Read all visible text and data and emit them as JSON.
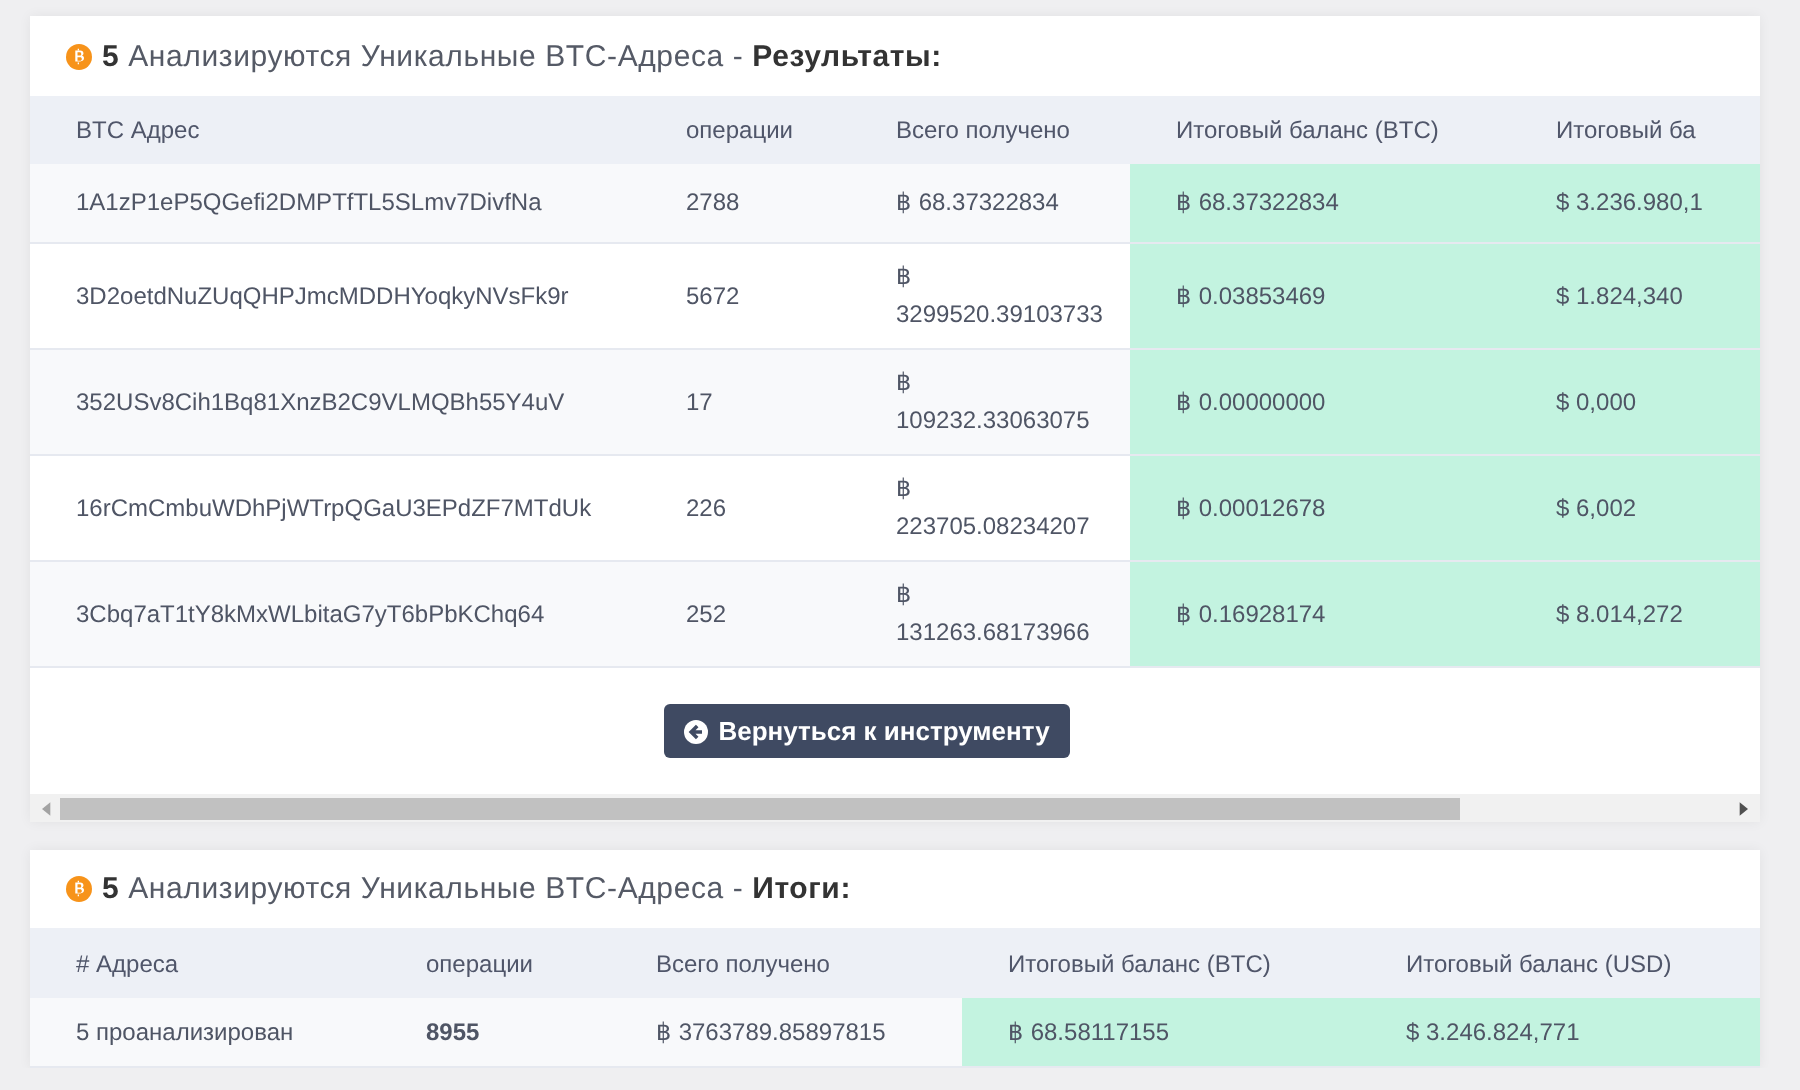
{
  "results": {
    "title": "**5** Анализируются Уникальные BTC-Адреса - **Результаты:**",
    "columns": [
      {
        "label": "BTC Адрес",
        "highlighted": false
      },
      {
        "label": "операции",
        "highlighted": false
      },
      {
        "label": "Всего получено",
        "highlighted": false
      },
      {
        "label": "Итоговый баланс (BTC)",
        "highlighted": true
      },
      {
        "label": "Итоговый ба",
        "highlighted": true
      }
    ],
    "rows": [
      [
        "1A1zP1eP5QGefi2DMPTfTL5SLmv7DivfNa",
        "2788",
        "฿ 68.37322834",
        "฿ 68.37322834",
        "$ 3.236.980,1"
      ],
      [
        "3D2oetdNuZUqQHPJmcMDDHYoqkyNVsFk9r",
        "5672",
        "฿ 3299520.39103733",
        "฿ 0.03853469",
        "$ 1.824,340"
      ],
      [
        "352USv8Cih1Bq81XnzB2C9VLMQBh55Y4uV",
        "17",
        "฿ 109232.33063075",
        "฿ 0.00000000",
        "$ 0,000"
      ],
      [
        "16rCmCmbuWDhPjWTrpQGaU3EPdZF7MTdUk",
        "226",
        "฿ 223705.08234207",
        "฿ 0.00012678",
        "$ 6,002"
      ],
      [
        "3Cbq7aT1tY8kMxWLbitaG7yT6bPbKChq64",
        "252",
        "฿ 131263.68173966",
        "฿ 0.16928174",
        "$ 8.014,272"
      ]
    ],
    "button": "Вернуться к инструменту"
  },
  "totals": {
    "title": "**5** Анализируются Уникальные BTC-Адреса - **Итоги:**",
    "columns": [
      {
        "label": "# Адреса",
        "highlighted": false
      },
      {
        "label": "операции",
        "highlighted": false
      },
      {
        "label": "Всего получено",
        "highlighted": false
      },
      {
        "label": "Итоговый баланс (BTC)",
        "highlighted": true
      },
      {
        "label": "Итоговый баланс (USD)",
        "highlighted": true
      }
    ],
    "rows": [
      [
        "5 проанализирован",
        "8955",
        "฿ 3763789.85897815",
        "฿ 68.58117155",
        "$ 3.246.824,771"
      ]
    ]
  }
}
